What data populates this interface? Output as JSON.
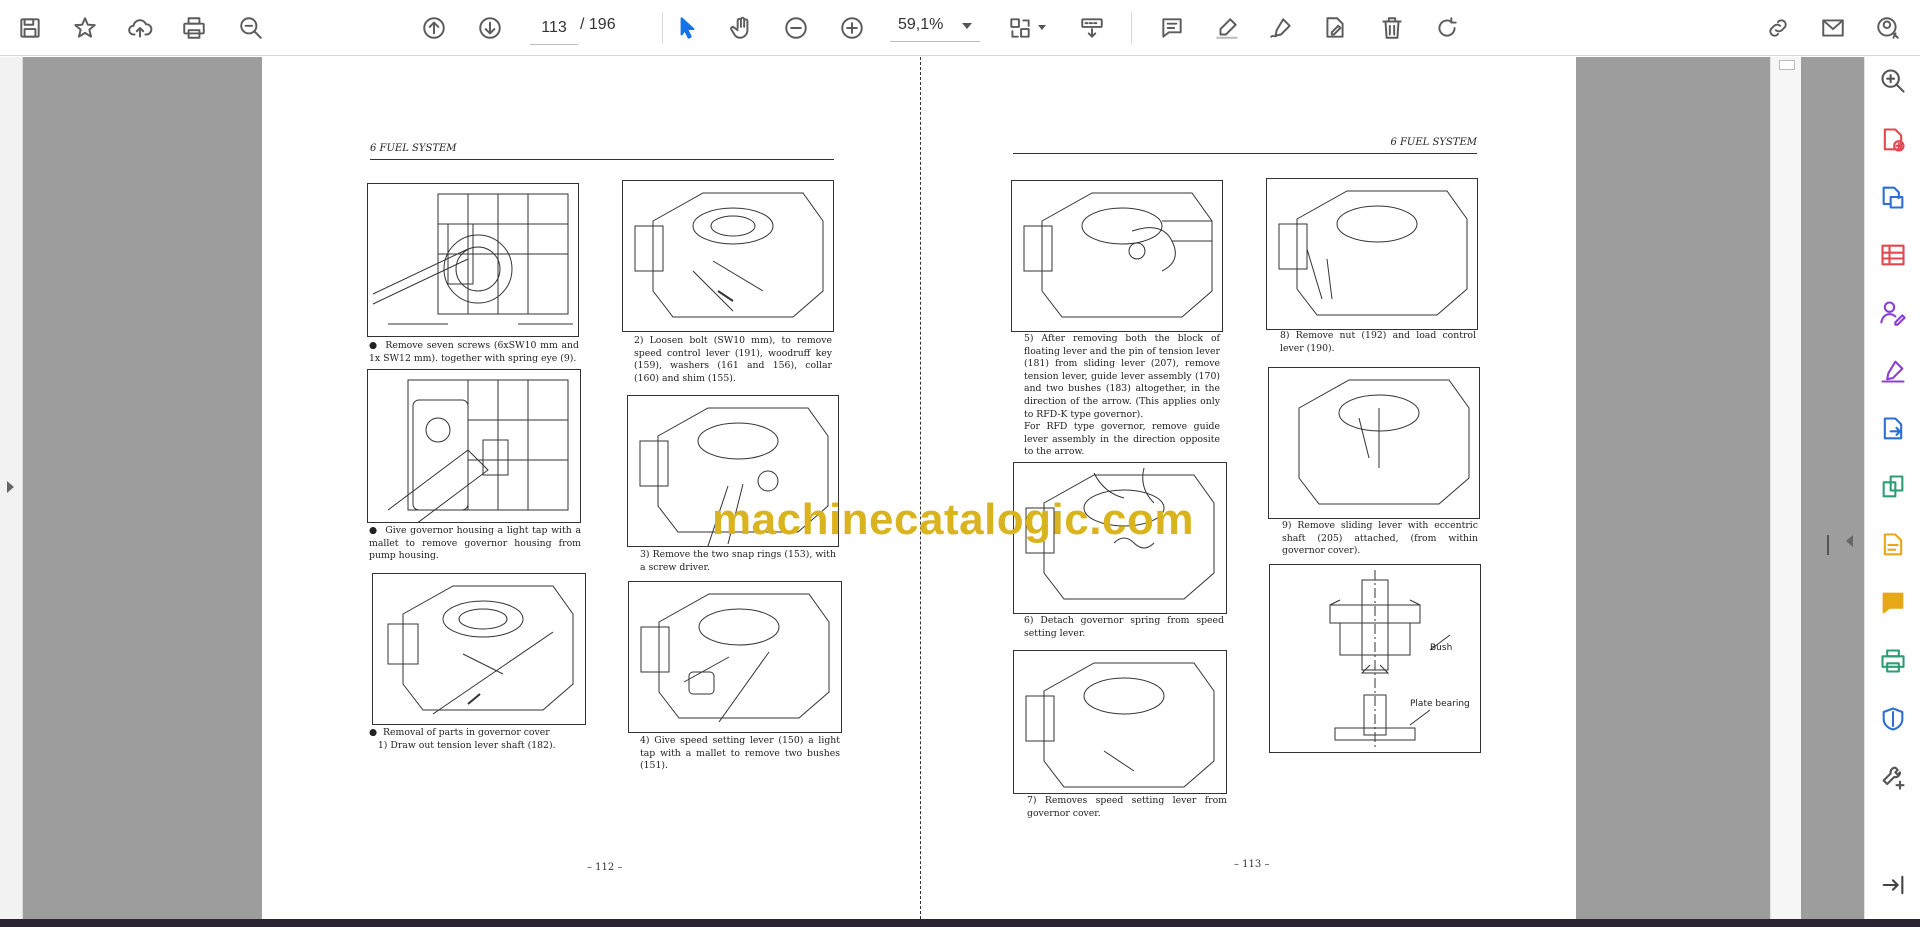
{
  "toolbar": {
    "current_page": "113",
    "total_pages": "/ 196",
    "zoom": "59,1%",
    "icons": [
      "save-icon",
      "bookmark-star-icon",
      "upload-cloud-icon",
      "print-icon",
      "zoom-search-icon",
      "page-up-icon",
      "page-down-icon",
      "select-cursor-icon",
      "hand-pan-icon",
      "zoom-out-icon",
      "zoom-in-icon",
      "page-fit-icon",
      "scroll-mode-icon",
      "comment-icon",
      "highlight-pen-icon",
      "draw-signature-icon",
      "fill-sign-icon",
      "delete-icon",
      "rotate-icon",
      "share-link-icon",
      "email-icon",
      "account-icon"
    ]
  },
  "right_tools": [
    "zoom-icon",
    "create-pdf-icon",
    "export-pdf-icon",
    "organize-pages-icon",
    "request-signature-icon",
    "fill-sign-icon",
    "export-file-icon",
    "compress-icon",
    "edit-pdf-icon",
    "comment-tool-icon",
    "print-production-icon",
    "protect-icon",
    "more-tools-icon",
    "collapse-panel-icon"
  ],
  "document": {
    "left_page": {
      "header": "6 FUEL SYSTEM",
      "page_number": "– 112 –",
      "captions": [
        {
          "bullet": "●",
          "text": "Remove seven screws (6xSW10 mm and 1x SW12 mm). together with spring eye (9)."
        },
        {
          "bullet": "",
          "text": "2) Loosen bolt (SW10 mm), to remove speed control lever (191), woodruff key (159), washers (161 and 156), collar (160) and shim (155)."
        },
        {
          "bullet": "●",
          "text": "Give governor housing a light tap with a mallet to remove governor housing from pump housing."
        },
        {
          "bullet": "",
          "text": "3) Remove the two snap rings (153), with a screw driver."
        },
        {
          "bullet": "●",
          "text": "Removal of parts in governor cover"
        },
        {
          "bullet": "",
          "text": "1) Draw out tension lever shaft (182)."
        },
        {
          "bullet": "",
          "text": "4) Give speed setting lever (150) a light tap with a mallet to remove two bushes (151)."
        }
      ]
    },
    "right_page": {
      "header": "6 FUEL SYSTEM",
      "page_number": "– 113 –",
      "captions": [
        {
          "text": "5) After removing both the block of floating lever and the pin of tension lever (181) from sliding lever (207), remove tension lever, guide lever assembly (170) and two bushes (183) altogether, in the direction of the arrow. (This applies only to RFD-K type governor)."
        },
        {
          "text": "For RFD type governor, remove guide lever assembly in the direction opposite to the arrow."
        },
        {
          "text": "8) Remove nut (192) and load control lever (190)."
        },
        {
          "text": "6) Detach governor spring from speed setting lever."
        },
        {
          "text": "9) Remove sliding lever with eccentric shaft (205) attached, (from within governor cover)."
        },
        {
          "text": "7) Removes speed setting lever from governor cover."
        }
      ],
      "diagram_labels": {
        "bush": "Bush",
        "plate_bearing": "Plate bearing"
      }
    }
  },
  "watermark": "machinecatalogic.com",
  "colors": {
    "accent": "#1473e6",
    "workspace": "#9d9d9d",
    "watermark": "#d9b41f",
    "tool_red": "#e34850",
    "tool_blue": "#2d6fd6",
    "tool_green": "#2d9d78",
    "tool_purple": "#8b3fd6",
    "tool_yellow": "#e6a817"
  }
}
